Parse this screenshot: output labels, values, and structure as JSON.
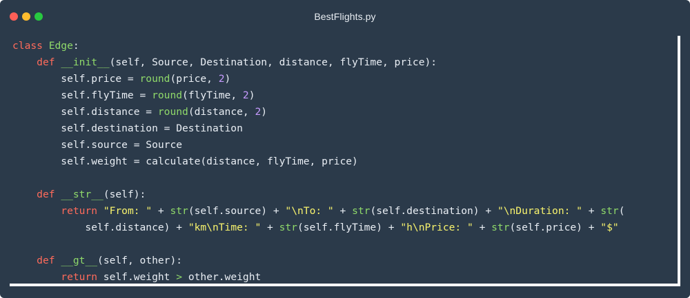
{
  "window": {
    "title": "BestFlights.py",
    "colors": {
      "background": "#2b3a4a",
      "close": "#ff5f57",
      "minimize": "#febc2e",
      "zoom": "#28c840",
      "keyword": "#ff6b5b",
      "builtin": "#8fd96a",
      "number": "#c79bff",
      "string": "#f8f36d",
      "text": "#e9eef4"
    }
  },
  "editor": {
    "lines": [
      [
        {
          "c": "kw",
          "t": "class"
        },
        {
          "c": "txt",
          "t": " "
        },
        {
          "c": "fn",
          "t": "Edge"
        },
        {
          "c": "txt",
          "t": ":"
        }
      ],
      [
        {
          "c": "txt",
          "t": "    "
        },
        {
          "c": "kw",
          "t": "def"
        },
        {
          "c": "txt",
          "t": " "
        },
        {
          "c": "fn",
          "t": "__init__"
        },
        {
          "c": "txt",
          "t": "(self, Source, Destination, distance, flyTime, price):"
        }
      ],
      [
        {
          "c": "txt",
          "t": "        self.price = "
        },
        {
          "c": "fn",
          "t": "round"
        },
        {
          "c": "txt",
          "t": "(price, "
        },
        {
          "c": "num",
          "t": "2"
        },
        {
          "c": "txt",
          "t": ")"
        }
      ],
      [
        {
          "c": "txt",
          "t": "        self.flyTime = "
        },
        {
          "c": "fn",
          "t": "round"
        },
        {
          "c": "txt",
          "t": "(flyTime, "
        },
        {
          "c": "num",
          "t": "2"
        },
        {
          "c": "txt",
          "t": ")"
        }
      ],
      [
        {
          "c": "txt",
          "t": "        self.distance = "
        },
        {
          "c": "fn",
          "t": "round"
        },
        {
          "c": "txt",
          "t": "(distance, "
        },
        {
          "c": "num",
          "t": "2"
        },
        {
          "c": "txt",
          "t": ")"
        }
      ],
      [
        {
          "c": "txt",
          "t": "        self.destination = Destination"
        }
      ],
      [
        {
          "c": "txt",
          "t": "        self.source = Source"
        }
      ],
      [
        {
          "c": "txt",
          "t": "        self.weight = calculate(distance, flyTime, price)"
        }
      ],
      [
        {
          "c": "txt",
          "t": ""
        }
      ],
      [
        {
          "c": "txt",
          "t": "    "
        },
        {
          "c": "kw",
          "t": "def"
        },
        {
          "c": "txt",
          "t": " "
        },
        {
          "c": "fn",
          "t": "__str__"
        },
        {
          "c": "txt",
          "t": "(self):"
        }
      ],
      [
        {
          "c": "txt",
          "t": "        "
        },
        {
          "c": "kw",
          "t": "return"
        },
        {
          "c": "txt",
          "t": " "
        },
        {
          "c": "str",
          "t": "\"From: \""
        },
        {
          "c": "txt",
          "t": " + "
        },
        {
          "c": "fn",
          "t": "str"
        },
        {
          "c": "txt",
          "t": "(self.source) + "
        },
        {
          "c": "str",
          "t": "\"\\nTo: \""
        },
        {
          "c": "txt",
          "t": " + "
        },
        {
          "c": "fn",
          "t": "str"
        },
        {
          "c": "txt",
          "t": "(self.destination) + "
        },
        {
          "c": "str",
          "t": "\"\\nDuration: \""
        },
        {
          "c": "txt",
          "t": " + "
        },
        {
          "c": "fn",
          "t": "str"
        },
        {
          "c": "txt",
          "t": "("
        }
      ],
      [
        {
          "c": "txt",
          "t": "            self.distance) + "
        },
        {
          "c": "str",
          "t": "\"km\\nTime: \""
        },
        {
          "c": "txt",
          "t": " + "
        },
        {
          "c": "fn",
          "t": "str"
        },
        {
          "c": "txt",
          "t": "(self.flyTime) + "
        },
        {
          "c": "str",
          "t": "\"h\\nPrice: \""
        },
        {
          "c": "txt",
          "t": " + "
        },
        {
          "c": "fn",
          "t": "str"
        },
        {
          "c": "txt",
          "t": "(self.price) + "
        },
        {
          "c": "str",
          "t": "\"$\""
        }
      ],
      [
        {
          "c": "txt",
          "t": ""
        }
      ],
      [
        {
          "c": "txt",
          "t": "    "
        },
        {
          "c": "kw",
          "t": "def"
        },
        {
          "c": "txt",
          "t": " "
        },
        {
          "c": "fn",
          "t": "__gt__"
        },
        {
          "c": "txt",
          "t": "(self, other):"
        }
      ],
      [
        {
          "c": "txt",
          "t": "        "
        },
        {
          "c": "kw",
          "t": "return"
        },
        {
          "c": "txt",
          "t": " self.weight "
        },
        {
          "c": "fn",
          "t": ">"
        },
        {
          "c": "txt",
          "t": " other.weight"
        }
      ]
    ]
  }
}
